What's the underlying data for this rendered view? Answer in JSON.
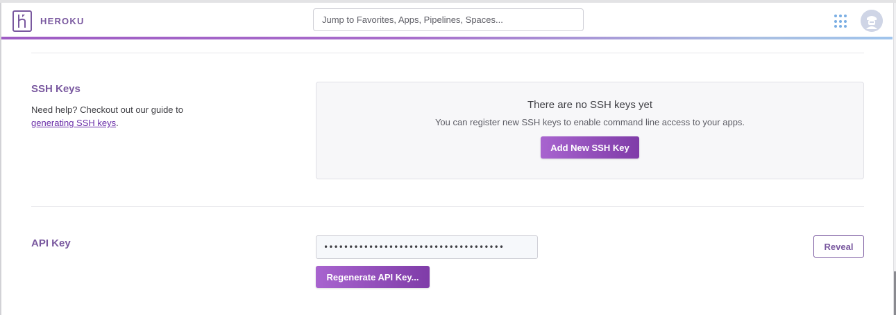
{
  "brand": {
    "name": "HEROKU",
    "color": "#79589f"
  },
  "header": {
    "search_placeholder": "Jump to Favorites, Apps, Pipelines, Spaces...",
    "apps_icon": "grid-icon",
    "avatar_icon": "user-avatar-icon"
  },
  "ssh": {
    "title": "SSH Keys",
    "help_prefix": "Need help? Checkout out our guide to",
    "help_link": "generating SSH keys",
    "help_suffix": ".",
    "empty_title": "There are no SSH keys yet",
    "empty_sub": "You can register new SSH keys to enable command line access to your apps.",
    "add_button": "Add New SSH Key"
  },
  "api": {
    "title": "API Key",
    "masked_value": "••••••••••••••••••••••••••••••••••••",
    "reveal_button": "Reveal",
    "regenerate_button": "Regenerate API Key..."
  },
  "colors": {
    "accent": "#79589f",
    "button_gradient_start": "#a864cf",
    "button_gradient_end": "#7f3ca8",
    "grid_icon": "#7aaee3"
  }
}
